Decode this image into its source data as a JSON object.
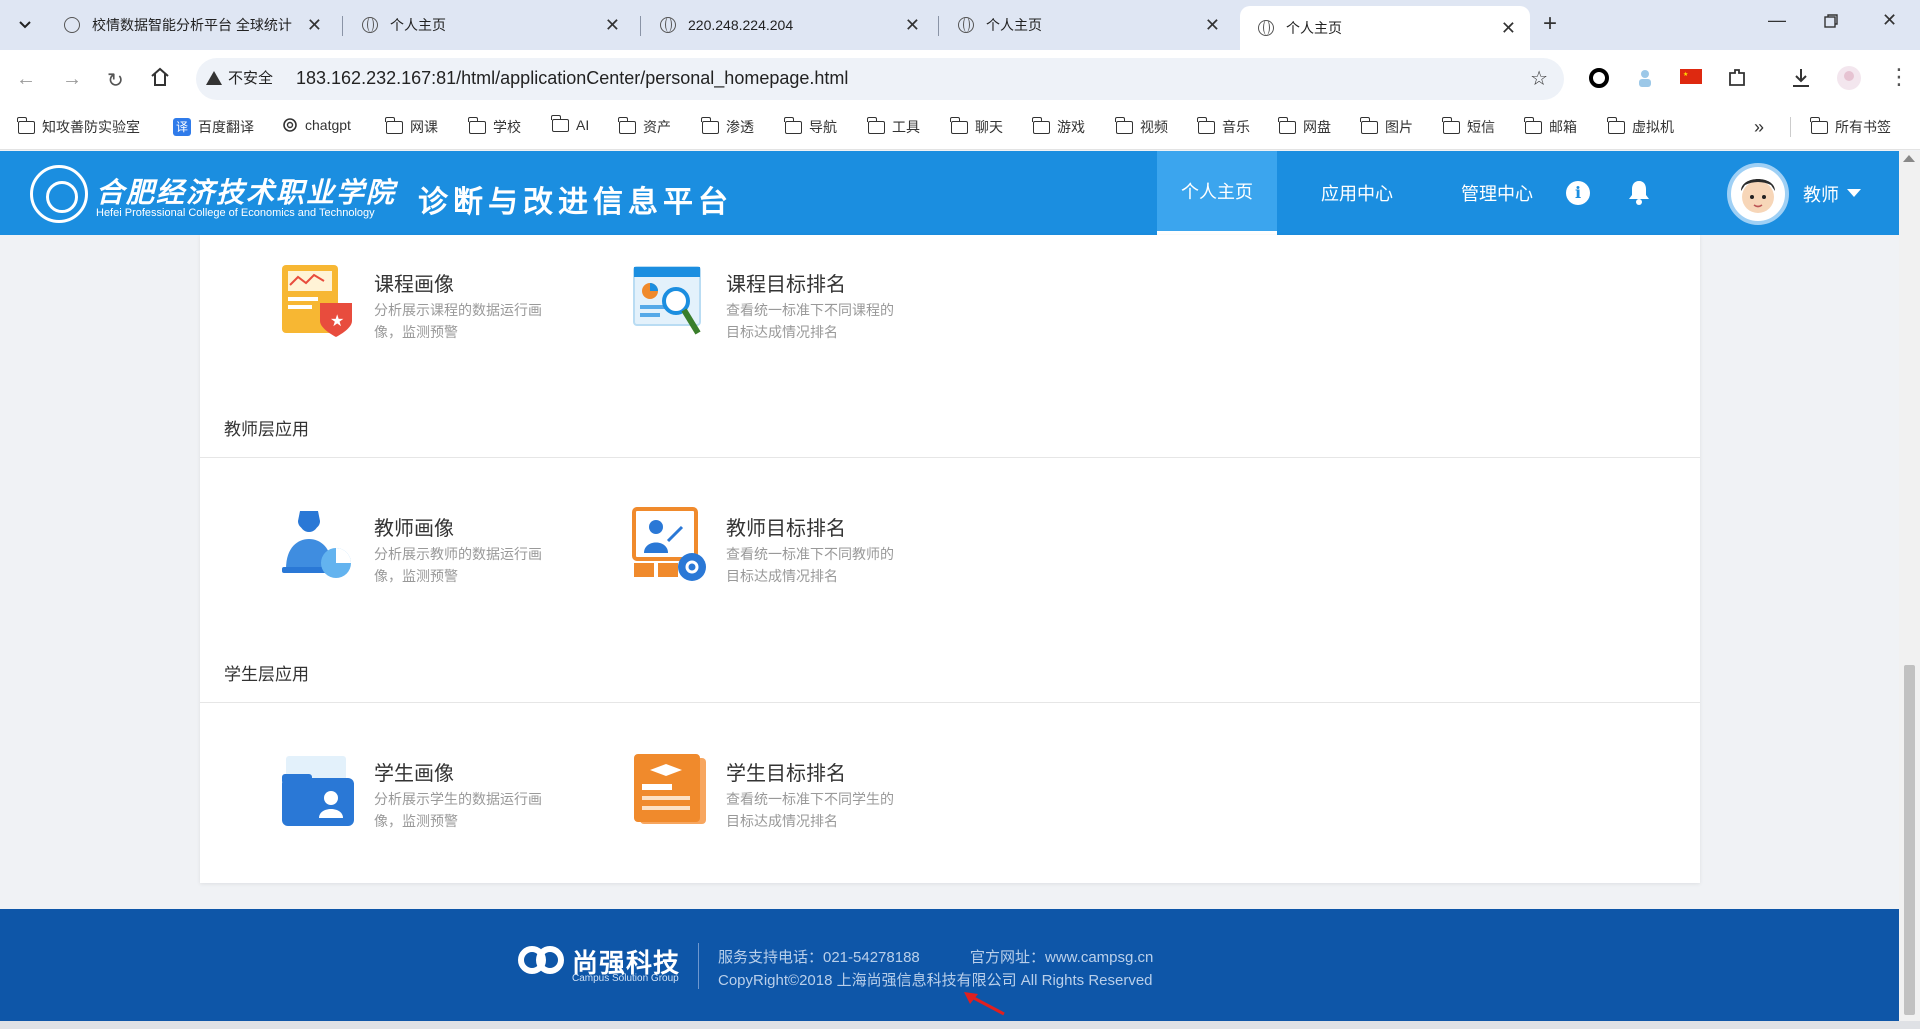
{
  "browser": {
    "tabs": [
      {
        "title": "校情数据智能分析平台 全球统计",
        "active": false
      },
      {
        "title": "个人主页",
        "active": false
      },
      {
        "title": "220.248.224.204",
        "active": false
      },
      {
        "title": "个人主页",
        "active": false
      },
      {
        "title": "个人主页",
        "active": true
      }
    ],
    "security_label": "不安全",
    "url": "183.162.232.167:81/html/applicationCenter/personal_homepage.html",
    "bookmarks": [
      "知攻善防实验室",
      "百度翻译",
      "chatgpt",
      "网课",
      "学校",
      "AI",
      "资产",
      "渗透",
      "导航",
      "工具",
      "聊天",
      "游戏",
      "视频",
      "音乐",
      "网盘",
      "图片",
      "短信",
      "邮箱",
      "虚拟机"
    ],
    "bookmarks_more": "»",
    "all_bookmarks": "所有书签",
    "translate_badge": "译"
  },
  "header": {
    "school_cn": "合肥经济技术职业学院",
    "school_en": "Hefei Professional College of Economics and Technology",
    "platform": "诊断与改进信息平台",
    "menu": [
      "个人主页",
      "应用中心",
      "管理中心"
    ],
    "active_menu": "个人主页",
    "user": "教师",
    "info_glyph": "i"
  },
  "sections": [
    {
      "title": "",
      "apps": [
        {
          "name": "课程画像",
          "desc": "分析展示课程的数据运行画像，监测预警",
          "icon": "course-portrait-icon"
        },
        {
          "name": "课程目标排名",
          "desc": "查看统一标准下不同课程的目标达成情况排名",
          "icon": "course-ranking-icon"
        }
      ]
    },
    {
      "title": "教师层应用",
      "apps": [
        {
          "name": "教师画像",
          "desc": "分析展示教师的数据运行画像，监测预警",
          "icon": "teacher-portrait-icon"
        },
        {
          "name": "教师目标排名",
          "desc": "查看统一标准下不同教师的目标达成情况排名",
          "icon": "teacher-ranking-icon"
        }
      ]
    },
    {
      "title": "学生层应用",
      "apps": [
        {
          "name": "学生画像",
          "desc": "分析展示学生的数据运行画像，监测预警",
          "icon": "student-portrait-icon"
        },
        {
          "name": "学生目标排名",
          "desc": "查看统一标准下不同学生的目标达成情况排名",
          "icon": "student-ranking-icon"
        }
      ]
    }
  ],
  "footer": {
    "brand": "尚强科技",
    "brand_en": "Campus Solution Group",
    "phone": "服务支持电话：021-54278188",
    "website": "官方网址：www.campsg.cn",
    "copyright": "CopyRight©2018 上海尚强信息科技有限公司 All Rights Reserved"
  },
  "colors": {
    "header_blue": "#1b8ee0",
    "footer_blue": "#0e56a8",
    "accent_orange": "#f08a2c"
  }
}
